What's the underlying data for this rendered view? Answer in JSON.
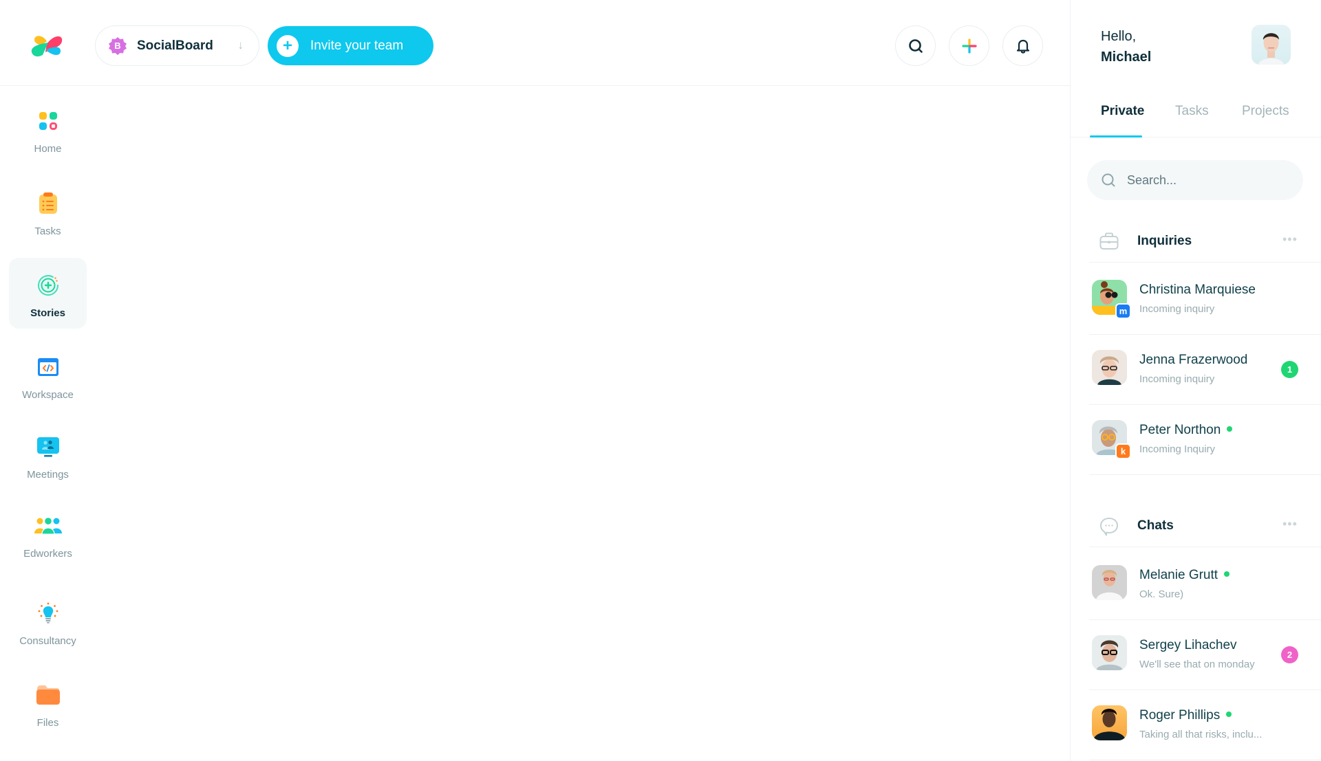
{
  "header": {
    "logo": "app-logo",
    "workspace": {
      "badge_letter": "B",
      "name": "SocialBoard",
      "arrow": "↓"
    },
    "invite_label": "Invite your team",
    "actions": [
      "search-icon",
      "add-icon",
      "bell-icon"
    ]
  },
  "sidebar": {
    "active": "Stories",
    "items": [
      {
        "label": "Home",
        "icon": "home-grid-icon"
      },
      {
        "label": "Tasks",
        "icon": "clipboard-icon"
      },
      {
        "label": "Stories",
        "icon": "stories-icon"
      },
      {
        "label": "Workspace",
        "icon": "code-window-icon"
      },
      {
        "label": "Meetings",
        "icon": "monitor-people-icon"
      },
      {
        "label": "Edworkers",
        "icon": "group-icon"
      },
      {
        "label": "Consultancy",
        "icon": "lightbulb-icon"
      },
      {
        "label": "Files",
        "icon": "folder-icon"
      }
    ]
  },
  "profile": {
    "greeting": "Hello,",
    "name": "Michael"
  },
  "tabs": [
    {
      "label": "Private",
      "active": true
    },
    {
      "label": "Tasks",
      "active": false
    },
    {
      "label": "Projects",
      "active": false
    }
  ],
  "search": {
    "placeholder": "Search...",
    "value": ""
  },
  "inquiries": {
    "title": "Inquiries",
    "more": "•••",
    "items": [
      {
        "name": "Christina Marquiese",
        "subtitle": "Incoming inquiry",
        "source_badge": "m",
        "source_color": "#1a7cf2",
        "online": false,
        "count": null
      },
      {
        "name": "Jenna Frazerwood",
        "subtitle": "Incoming inquiry",
        "source_badge": null,
        "online": false,
        "count": "1",
        "count_color": "#1ed672"
      },
      {
        "name": "Peter Northon",
        "subtitle": "Incoming Inquiry",
        "source_badge": "k",
        "source_color": "#ff7a1a",
        "online": true,
        "count": null
      }
    ]
  },
  "chats": {
    "title": "Chats",
    "more": "•••",
    "items": [
      {
        "name": "Melanie Grutt",
        "subtitle": "Ok. Sure)",
        "online": true,
        "count": null
      },
      {
        "name": "Sergey Lihachev",
        "subtitle": "We'll see that on monday",
        "online": false,
        "count": "2",
        "count_color": "#f062c8"
      },
      {
        "name": "Roger Phillips",
        "subtitle": "Taking all that risks, inclu...",
        "online": true,
        "count": null
      }
    ]
  },
  "colors": {
    "accent": "#0ec8ee",
    "text_dark": "#0f2f3a",
    "text_muted": "#98abaf",
    "online": "#1ed672"
  }
}
